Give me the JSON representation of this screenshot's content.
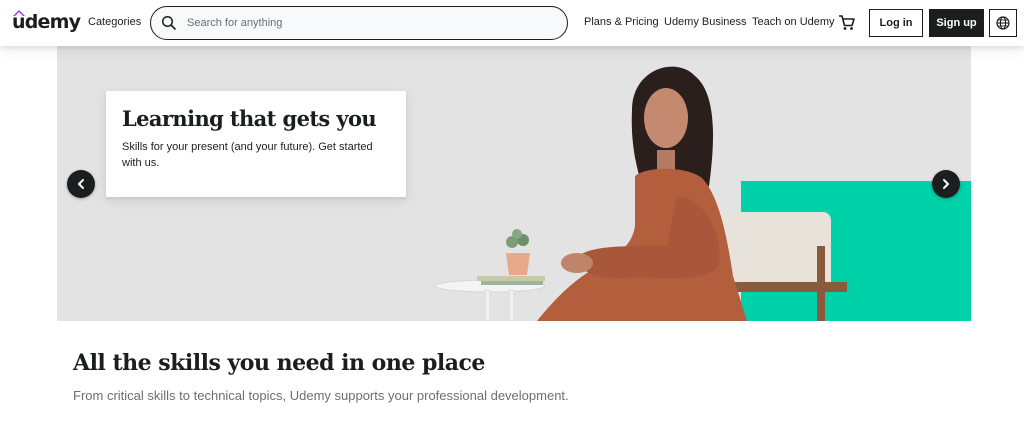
{
  "header": {
    "logo_text": "udemy",
    "categories_label": "Categories",
    "search": {
      "placeholder": "Search for anything",
      "value": ""
    },
    "nav_links": {
      "plans_pricing": "Plans & Pricing",
      "business": "Udemy Business",
      "teach": "Teach on Udemy"
    },
    "login_label": "Log in",
    "signup_label": "Sign up",
    "icons": {
      "search": "search-icon",
      "cart": "cart-icon",
      "language": "globe-icon"
    }
  },
  "hero": {
    "title": "Learning that gets you",
    "subtitle": "Skills for your present (and your future). Get started with us.",
    "prev_icon": "chevron-left-icon",
    "next_icon": "chevron-right-icon"
  },
  "skills": {
    "title": "All the skills you need in one place",
    "subtitle": "From critical skills to technical topics, Udemy supports your professional development."
  },
  "colors": {
    "brand_purple": "#a435f0",
    "text_dark": "#1c1d1f",
    "hero_background": "#e3e3e3",
    "hero_accent_teal": "#00d1a9",
    "muted_text": "#6a6f73"
  }
}
